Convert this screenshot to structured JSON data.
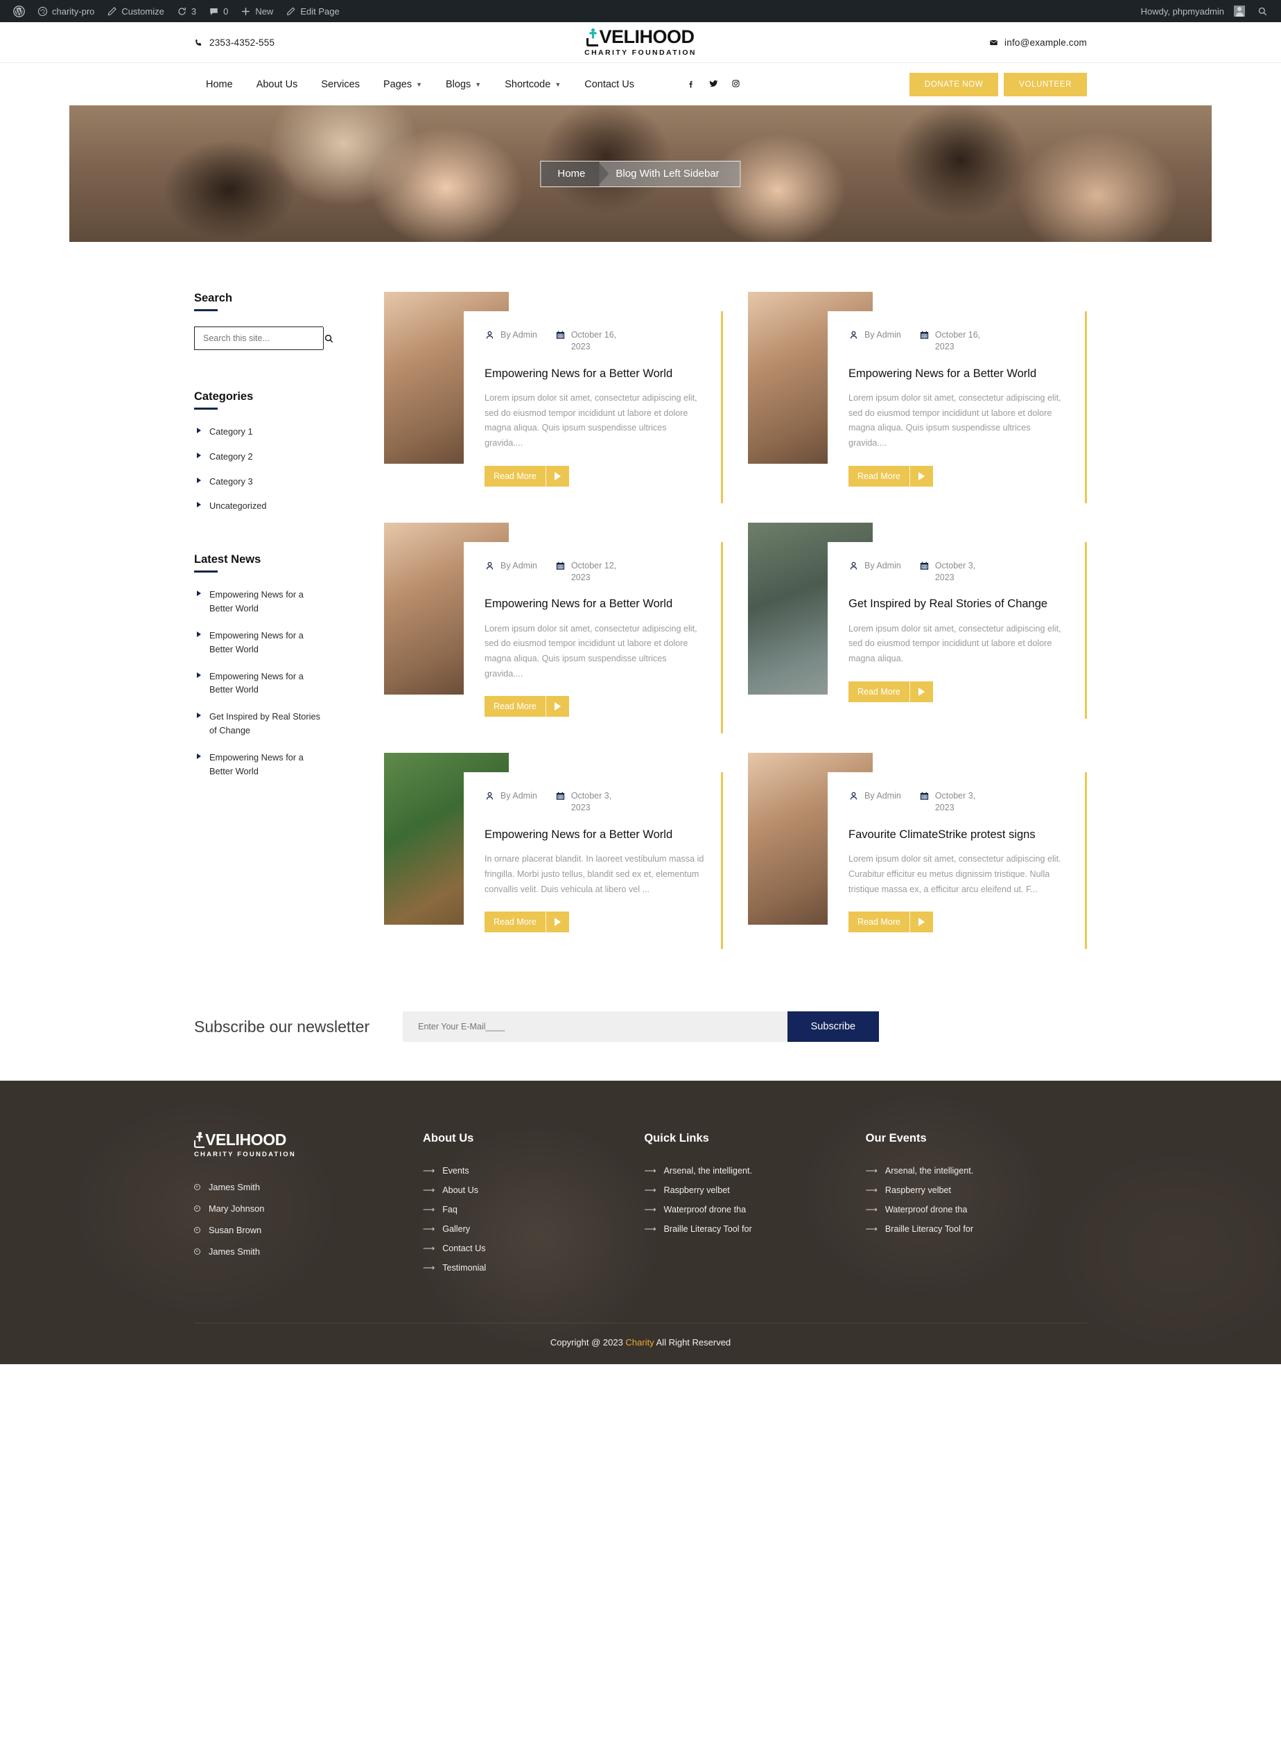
{
  "admin_bar": {
    "site_name": "charity-pro",
    "customize": "Customize",
    "updates_count": "3",
    "comments_count": "0",
    "new": "New",
    "edit_page": "Edit Page",
    "howdy": "Howdy, phpmyadmin"
  },
  "topbar": {
    "phone": "2353-4352-555",
    "email": "info@example.com",
    "logo_main": "VELIHOOD",
    "logo_sub": "CHARITY FOUNDATION"
  },
  "nav": {
    "items": [
      {
        "label": "Home",
        "has_caret": false
      },
      {
        "label": "About Us",
        "has_caret": false
      },
      {
        "label": "Services",
        "has_caret": false
      },
      {
        "label": "Pages",
        "has_caret": true
      },
      {
        "label": "Blogs",
        "has_caret": true
      },
      {
        "label": "Shortcode",
        "has_caret": true
      },
      {
        "label": "Contact Us",
        "has_caret": false
      }
    ],
    "social": [
      "f",
      "t",
      "i"
    ],
    "donate_label": "DONATE NOW",
    "volunteer_label": "VOLUNTEER"
  },
  "hero": {
    "breadcrumb_home": "Home",
    "breadcrumb_current": "Blog With Left Sidebar"
  },
  "sidebar": {
    "search": {
      "title": "Search",
      "placeholder": "Search this site...",
      "value": ""
    },
    "categories": {
      "title": "Categories",
      "items": [
        "Category 1",
        "Category 2",
        "Category 3",
        "Uncategorized"
      ]
    },
    "latest_news": {
      "title": "Latest News",
      "items": [
        "Empowering News for a Better World",
        "Empowering News for a Better World",
        "Empowering News for a Better World",
        "Get Inspired by Real Stories of Change",
        "Empowering News for a Better World"
      ]
    }
  },
  "posts": [
    {
      "author": "By Admin",
      "date": "October 16, 2023",
      "title": "Empowering News for a Better World",
      "excerpt": "Lorem ipsum dolor sit amet, consectetur adipiscing elit, sed do eiusmod tempor incididunt ut labore et dolore magna aliqua. Quis ipsum suspendisse ultrices gravida....",
      "read_more": "Read More",
      "thumb": "th-a"
    },
    {
      "author": "By Admin",
      "date": "October 16, 2023",
      "title": "Empowering News for a Better World",
      "excerpt": "Lorem ipsum dolor sit amet, consectetur adipiscing elit, sed do eiusmod tempor incididunt ut labore et dolore magna aliqua. Quis ipsum suspendisse ultrices gravida....",
      "read_more": "Read More",
      "thumb": "th-a"
    },
    {
      "author": "By Admin",
      "date": "October 12, 2023",
      "title": "Empowering News for a Better World",
      "excerpt": "Lorem ipsum dolor sit amet, consectetur adipiscing elit, sed do eiusmod tempor incididunt ut labore et dolore magna aliqua. Quis ipsum suspendisse ultrices gravida....",
      "read_more": "Read More",
      "thumb": "th-a"
    },
    {
      "author": "By Admin",
      "date": "October 3, 2023",
      "title": "Get Inspired by Real Stories of Change",
      "excerpt": "Lorem ipsum dolor sit amet, consectetur adipiscing elit, sed do eiusmod tempor incididunt ut labore et dolore magna aliqua.",
      "read_more": "Read More",
      "thumb": "th-b"
    },
    {
      "author": "By Admin",
      "date": "October 3, 2023",
      "title": "Empowering News for a Better World",
      "excerpt": "In ornare placerat blandit. In laoreet vestibulum massa id fringilla. Morbi justo tellus, blandit sed ex et, elementum convallis velit. Duis vehicula at libero vel ...",
      "read_more": "Read More",
      "thumb": "th-c"
    },
    {
      "author": "By Admin",
      "date": "October 3, 2023",
      "title": "Favourite ClimateStrike protest signs",
      "excerpt": "Lorem ipsum dolor sit amet, consectetur adipiscing elit. Curabitur efficitur eu metus dignissim tristique. Nulla tristique massa ex, a efficitur arcu eleifend ut. F...",
      "read_more": "Read More",
      "thumb": "th-a"
    }
  ],
  "newsletter": {
    "title": "Subscribe our newsletter",
    "placeholder": "Enter Your E-Mail____",
    "value": "",
    "button": "Subscribe"
  },
  "footer": {
    "logo_main": "VELIHOOD",
    "logo_sub": "CHARITY FOUNDATION",
    "people": [
      "James Smith",
      "Mary Johnson",
      "Susan Brown",
      "James Smith"
    ],
    "columns": [
      {
        "title": "About Us",
        "links": [
          "Events",
          "About Us",
          "Faq",
          "Gallery",
          "Contact Us",
          "Testimonial"
        ]
      },
      {
        "title": "Quick Links",
        "links": [
          "Arsenal, the intelligent.",
          "Raspberry velbet",
          "Waterproof drone tha",
          "Braille Literacy Tool for"
        ]
      },
      {
        "title": "Our Events",
        "links": [
          "Arsenal, the intelligent.",
          "Raspberry velbet",
          "Waterproof drone tha",
          "Braille Literacy Tool for"
        ]
      }
    ],
    "copyright_pre": "Copyright @ 2023 ",
    "copyright_highlight": "Charity",
    "copyright_post": " All Right Reserved"
  },
  "colors": {
    "accent_yellow": "#edc651",
    "navy": "#12264d",
    "subscribe_navy": "#13255a",
    "logo_teal": "#18b5a7",
    "copyright_gold": "#edaa2b"
  }
}
